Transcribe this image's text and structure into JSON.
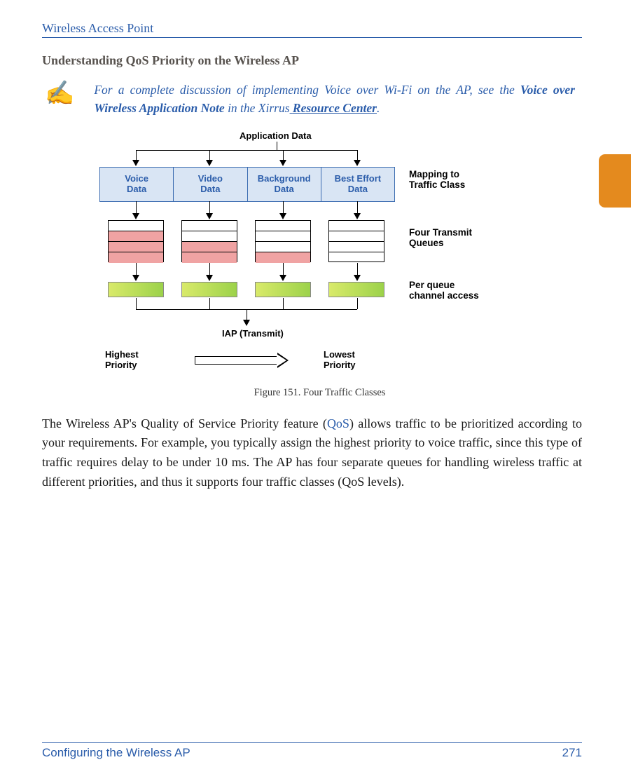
{
  "header": {
    "title": "Wireless Access Point"
  },
  "section": {
    "title": "Understanding QoS Priority on the Wireless AP"
  },
  "note": {
    "pre": "For a complete discussion of implementing Voice over Wi-Fi on the AP, see the ",
    "appnote": "Voice over Wireless Application Note",
    "mid": " in the Xirrus",
    "link_prefix": " ",
    "link": "Resource Center",
    "post": "."
  },
  "figure": {
    "caption": "Figure 151. Four Traffic Classes",
    "appdata": "Application Data",
    "classes": [
      "Voice\nData",
      "Video\nData",
      "Background\nData",
      "Best Effort\nData"
    ],
    "right_labels": {
      "mapping": "Mapping to\nTraffic Class",
      "queues": "Four Transmit\nQueues",
      "channel": "Per queue\nchannel access"
    },
    "iap": "IAP (Transmit)",
    "highest": "Highest\nPriority",
    "lowest": "Lowest\nPriority"
  },
  "paragraph": {
    "p1a": "The Wireless AP's Quality of Service Priority feature (",
    "qos": "QoS",
    "p1b": ") allows traffic to be prioritized according to your requirements. For example, you typically assign the highest priority to voice traffic, since this type of traffic requires delay to be under 10 ms. The AP has four separate queues for handling wireless traffic at different priorities, and thus it supports four traffic classes (QoS levels)."
  },
  "footer": {
    "left": "Configuring the Wireless AP",
    "right": "271"
  }
}
